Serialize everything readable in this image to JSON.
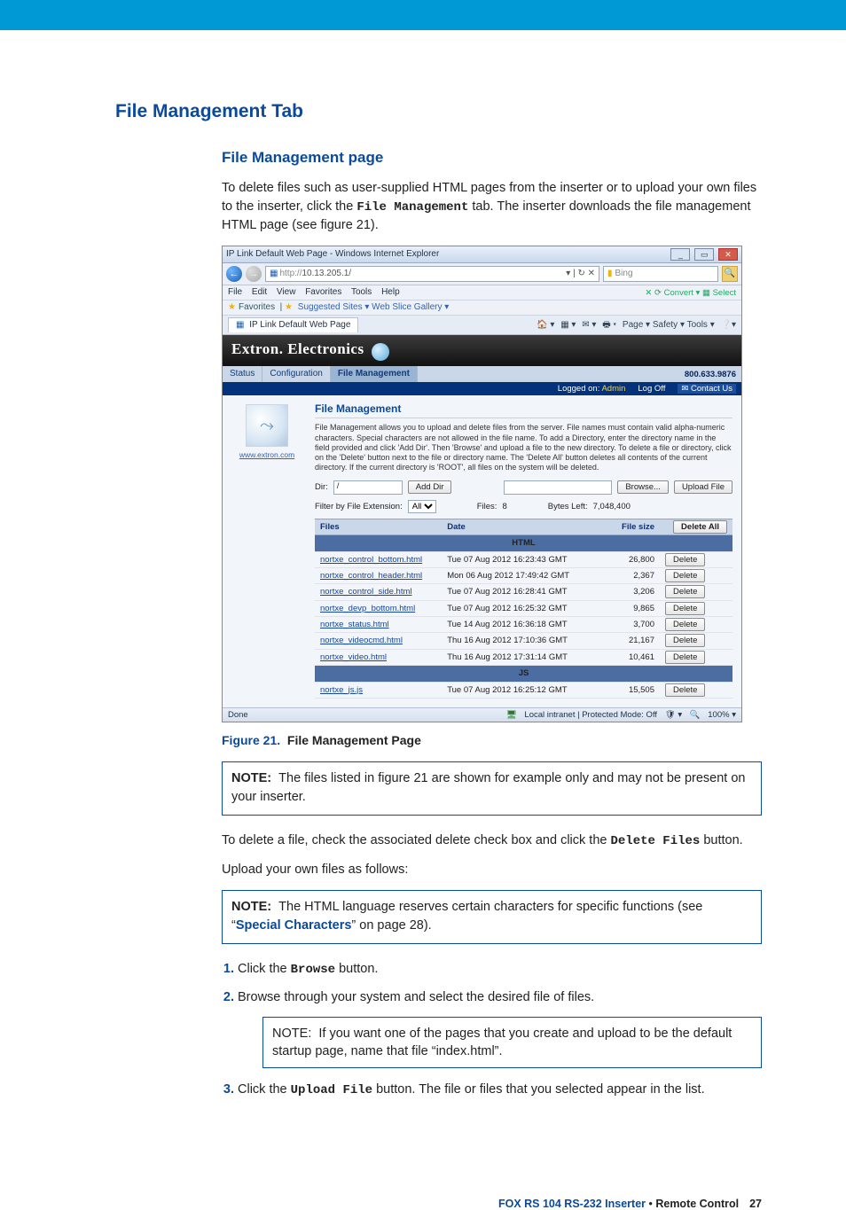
{
  "headings": {
    "main": "File Management Tab",
    "sub": "File Management page"
  },
  "intro_parts": {
    "a": "To delete files such as user-supplied HTML pages from the inserter or to upload your own files to the inserter, click the ",
    "b": "File Management",
    "c": " tab. The inserter downloads the file management HTML page (see figure 21)."
  },
  "figure": {
    "label": "Figure 21.",
    "title": "File Management Page"
  },
  "note1": {
    "label": "NOTE:",
    "text": "The files listed in figure 21 are shown for example only and may not be present on your inserter."
  },
  "delete_parts": {
    "a": "To delete a file, check the associated delete check box and click the ",
    "b": "Delete Files",
    "c": " button."
  },
  "upload_intro": "Upload your own files as follows:",
  "note2": {
    "label": "NOTE:",
    "a": "The HTML language reserves certain characters for specific functions (see “",
    "link": "Special Characters",
    "b": "” on page 28)."
  },
  "steps": {
    "s1a": "Click the ",
    "s1b": "Browse",
    "s1c": " button.",
    "s2": "Browse through your system and select the desired file of files.",
    "s2note_label": "NOTE:",
    "s2note_text": "If you want one of the pages that you create and upload to be the default startup page, name that file “index.html”.",
    "s3a": "Click the ",
    "s3b": "Upload File",
    "s3c": " button. The file or files that you selected appear in the list."
  },
  "footer": {
    "product": "FOX RS 104 RS-232 Inserter",
    "bullet": " • ",
    "section": "Remote Control",
    "page": "27"
  },
  "ie": {
    "title": "IP Link Default Web Page - Windows Internet Explorer",
    "url_prefix": "http://",
    "url": "10.13.205.1/",
    "search_hint": "Bing",
    "menu": [
      "File",
      "Edit",
      "View",
      "Favorites",
      "Tools",
      "Help"
    ],
    "convert": "Convert",
    "select": "Select",
    "fav_label": "Favorites",
    "fav_items": "Suggested Sites ▾   Web Slice Gallery ▾",
    "tab": "IP Link Default Web Page",
    "tools": "Page ▾   Safety ▾   Tools ▾",
    "status_done": "Done",
    "status_zone": "Local intranet | Protected Mode: Off",
    "status_zoom": "100%"
  },
  "extron": {
    "brand": "Extron. Electronics",
    "tabs": [
      "Status",
      "Configuration",
      "File Management"
    ],
    "phone": "800.633.9876",
    "logged": "Logged on: ",
    "admin": "Admin",
    "logoff": "Log Off",
    "contact": "Contact Us",
    "side_url": "www.extron.com"
  },
  "fm": {
    "title": "File Management",
    "desc": "File Management allows you to upload and delete files from the server. File names must contain valid alpha-numeric characters. Special characters are not allowed in the file name. To add a Directory, enter the directory name in the field provided and click 'Add Dir'. Then 'Browse' and upload a file to the new directory. To delete a file or directory, click on the 'Delete' button next to the file or directory name. The 'Delete All' button deletes all contents of the current directory. If the current directory is 'ROOT', all files on the system will be deleted.",
    "dir_label": "Dir:",
    "dir_value": "/",
    "add_dir": "Add Dir",
    "browse": "Browse...",
    "upload": "Upload File",
    "filter_label": "Filter by File Extension:",
    "filter_value": "All",
    "files_label": "Files:",
    "files_count": "8",
    "bytes_label": "Bytes Left:",
    "bytes_value": "7,048,400",
    "cols": {
      "files": "Files",
      "date": "Date",
      "size": "File size"
    },
    "delete_all": "Delete All",
    "delete": "Delete",
    "groups": [
      "HTML",
      "JS"
    ],
    "rows_html": [
      {
        "name": "nortxe_control_bottom.html",
        "date": "Tue 07 Aug 2012 16:23:43 GMT",
        "size": "26,800"
      },
      {
        "name": "nortxe_control_header.html",
        "date": "Mon 06 Aug 2012 17:49:42 GMT",
        "size": "2,367"
      },
      {
        "name": "nortxe_control_side.html",
        "date": "Tue 07 Aug 2012 16:28:41 GMT",
        "size": "3,206"
      },
      {
        "name": "nortxe_devp_bottom.html",
        "date": "Tue 07 Aug 2012 16:25:32 GMT",
        "size": "9,865"
      },
      {
        "name": "nortxe_status.html",
        "date": "Tue 14 Aug 2012 16:36:18 GMT",
        "size": "3,700"
      },
      {
        "name": "nortxe_videocmd.html",
        "date": "Thu 16 Aug 2012 17:10:36 GMT",
        "size": "21,167"
      },
      {
        "name": "nortxe_video.html",
        "date": "Thu 16 Aug 2012 17:31:14 GMT",
        "size": "10,461"
      }
    ],
    "rows_js": [
      {
        "name": "nortxe_js.js",
        "date": "Tue 07 Aug 2012 16:25:12 GMT",
        "size": "15,505"
      }
    ]
  }
}
